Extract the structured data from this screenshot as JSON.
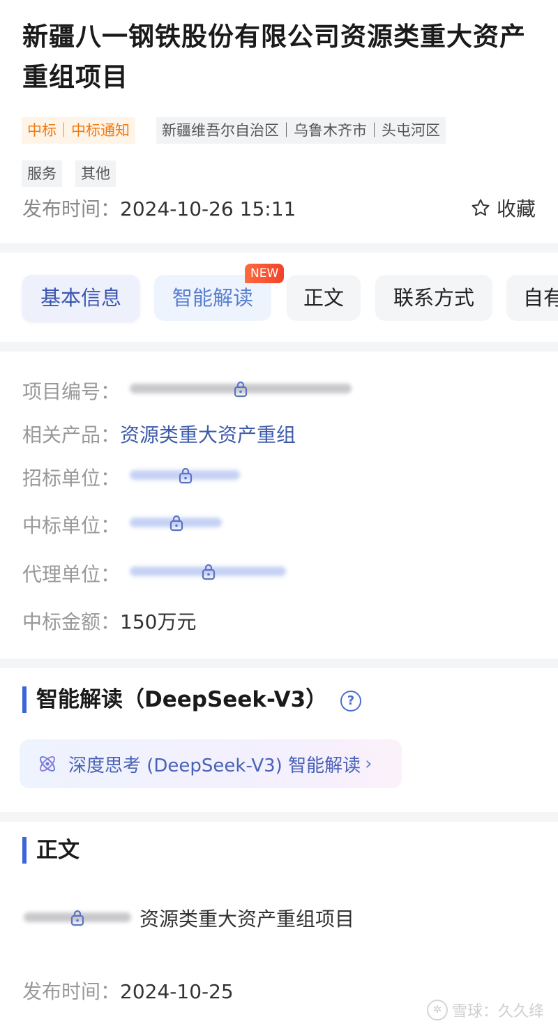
{
  "header": {
    "title": "新疆八一钢铁股份有限公司资源类重大资产重组项目",
    "tag_status": "中标｜中标通知",
    "tag_region": "新疆维吾尔自治区｜乌鲁木齐市｜头屯河区",
    "tag_category_1": "服务",
    "tag_category_2": "其他",
    "publish_label": "发布时间：",
    "publish_time": "2024-10-26 15:11",
    "favorite_label": "收藏"
  },
  "tabs": [
    {
      "label": "基本信息"
    },
    {
      "label": "智能解读"
    },
    {
      "label": "正文"
    },
    {
      "label": "联系方式"
    },
    {
      "label": "自有"
    }
  ],
  "new_badge": "NEW",
  "info": {
    "project_no_label": "项目编号：",
    "product_label": "相关产品：",
    "product_value": "资源类重大资产重组",
    "tenderer_label": "招标单位：",
    "winner_label": "中标单位：",
    "agent_label": "代理单位：",
    "amount_label": "中标金额：",
    "amount_value": "150万元"
  },
  "ai_section": {
    "title": "智能解读（DeepSeek-V3）",
    "help": "?",
    "entry_text": "深度思考 (DeepSeek-V3) 智能解读",
    "chevron": "›"
  },
  "body_section": {
    "title": "正文",
    "line_text": "资源类重大资产重组项目",
    "publish_label": "发布时间：",
    "publish_date": "2024-10-25"
  },
  "watermark": {
    "text": "雪球：久久绛"
  },
  "colors": {
    "accent_blue": "#3b66d8",
    "link_blue": "#3e5bab",
    "orange": "#f07a10",
    "badge_red": "#f0442b"
  },
  "icons": [
    "star-icon",
    "lock-icon",
    "question-icon",
    "atom-icon",
    "chevron-right-icon"
  ]
}
